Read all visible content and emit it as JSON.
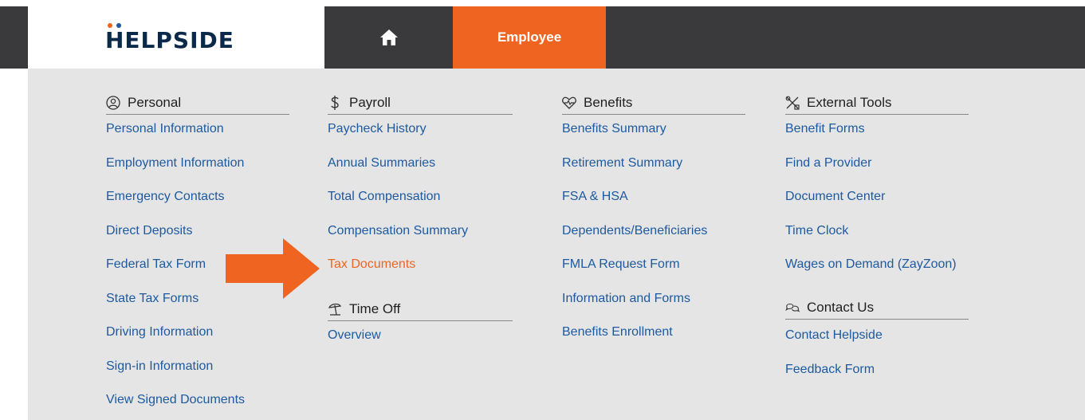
{
  "header": {
    "logo_text": "HELPSIDE",
    "logo_dot_colors": [
      "#ef6421",
      "#1d5aa0"
    ],
    "home_icon": "home-icon",
    "active_tab": "Employee"
  },
  "colors": {
    "bar": "#3a3a3c",
    "accent": "#ef6421",
    "panel": "#e5e5e5",
    "link": "#1d5aa0"
  },
  "menu": {
    "personal": {
      "title": "Personal",
      "icon": "user-circle-icon",
      "items": [
        "Personal Information",
        "Employment Information",
        "Emergency Contacts",
        "Direct Deposits",
        "Federal Tax Form",
        "State Tax Forms",
        "Driving Information",
        "Sign-in Information",
        "View Signed Documents"
      ]
    },
    "payroll": {
      "title": "Payroll",
      "icon": "dollar-icon",
      "items": [
        "Paycheck History",
        "Annual Summaries",
        "Total Compensation",
        "Compensation Summary",
        "Tax Documents"
      ],
      "highlighted": "Tax Documents"
    },
    "time_off": {
      "title": "Time Off",
      "icon": "beach-umbrella-icon",
      "items": [
        "Overview"
      ]
    },
    "benefits": {
      "title": "Benefits",
      "icon": "heart-pulse-icon",
      "items": [
        "Benefits Summary",
        "Retirement Summary",
        "FSA & HSA",
        "Dependents/Beneficiaries",
        "FMLA Request Form",
        "Information and Forms",
        "Benefits Enrollment"
      ]
    },
    "external_tools": {
      "title": "External Tools",
      "icon": "tools-icon",
      "items": [
        "Benefit Forms",
        "Find a Provider",
        "Document Center",
        "Time Clock",
        "Wages on Demand (ZayZoon)"
      ]
    },
    "contact_us": {
      "title": "Contact Us",
      "icon": "chat-bubbles-icon",
      "items": [
        "Contact Helpside",
        "Feedback Form"
      ]
    }
  },
  "annotation": {
    "icon": "arrow-right-icon"
  }
}
